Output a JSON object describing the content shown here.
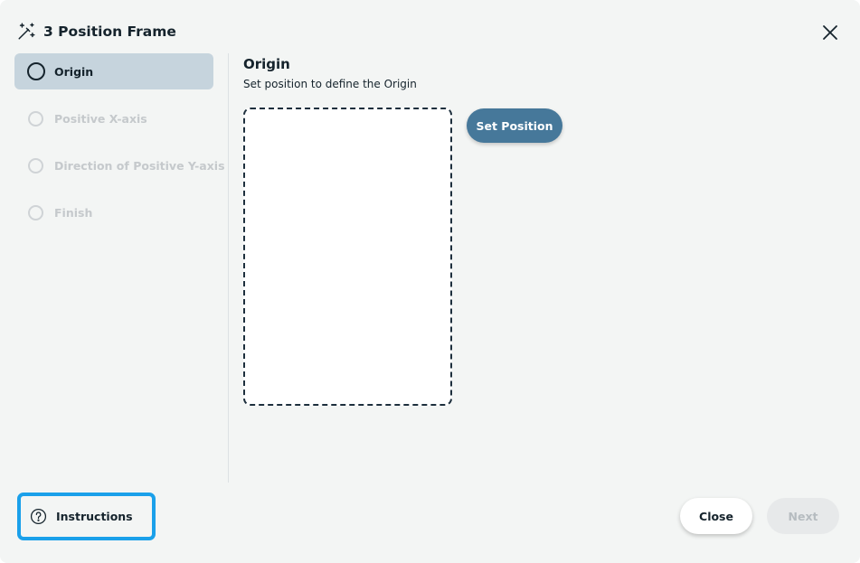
{
  "dialog": {
    "title": "3 Position Frame",
    "title_icon": "magic-wand-icon",
    "close_icon": "close-icon"
  },
  "steps": [
    {
      "label": "Origin",
      "state": "active"
    },
    {
      "label": "Positive X-axis",
      "state": "disabled"
    },
    {
      "label": "Direction of Positive Y-axis",
      "state": "disabled"
    },
    {
      "label": "Finish",
      "state": "disabled"
    }
  ],
  "content": {
    "title": "Origin",
    "subtitle": "Set position to define the Origin",
    "set_position_label": "Set Position"
  },
  "footer": {
    "instructions_label": "Instructions",
    "instructions_icon": "question-circle-icon",
    "close_label": "Close",
    "next_label": "Next"
  },
  "colors": {
    "accent": "#46789a",
    "active_step_bg": "#c6d4dd",
    "highlight_border": "#1aa0ea",
    "dialog_bg": "#f3f5f4"
  }
}
